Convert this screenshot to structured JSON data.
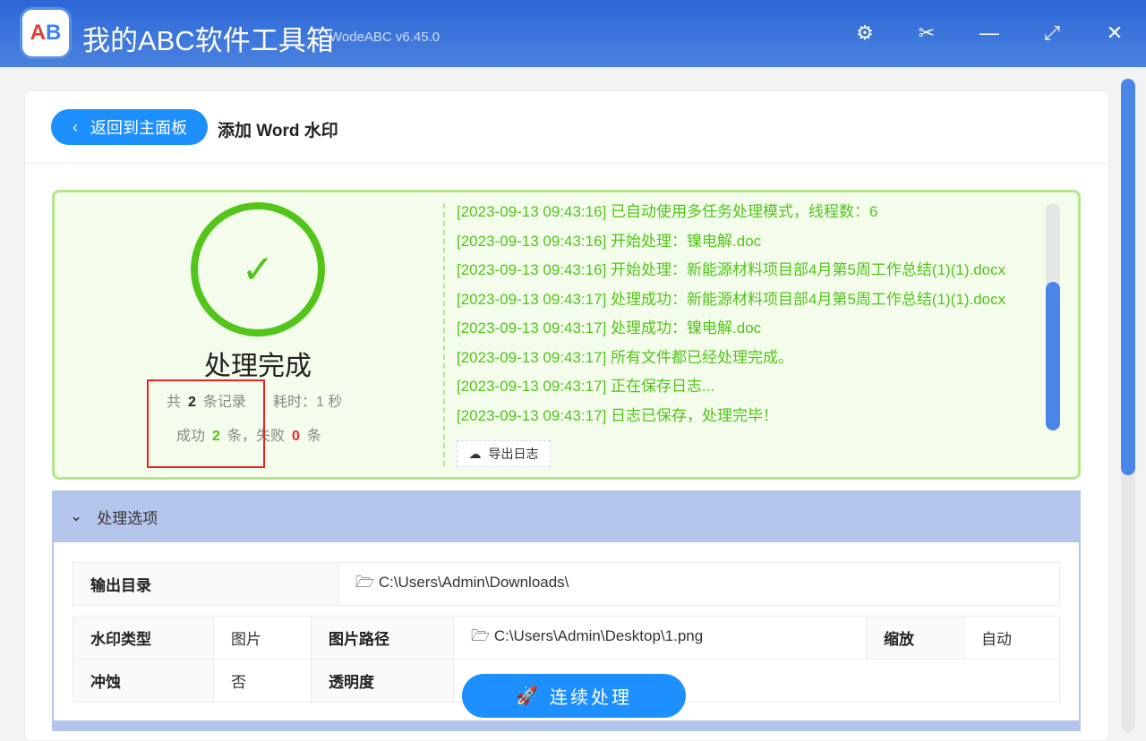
{
  "app": {
    "logo_text": "AB",
    "title": "我的ABC软件工具箱",
    "version": "WodeABC v6.45.0"
  },
  "window_controls": {
    "settings": "⚙",
    "scissors": "✂",
    "minimize": "—",
    "maximize": "⤢",
    "close": "✕"
  },
  "header": {
    "back_label": "返回到主面板",
    "page_title": "添加 Word 水印"
  },
  "result": {
    "status": "处理完成",
    "total_prefix": "共",
    "total": "2",
    "total_suffix": "条记录",
    "time_label": "耗时：1 秒",
    "success_label": "成功",
    "success": "2",
    "success_unit": "条，",
    "fail_label": "失败",
    "fail": "0",
    "fail_unit": "条",
    "log_lines": [
      "[2023-09-13 09:43:16] 已自动使用多任务处理模式，线程数：6",
      "[2023-09-13 09:43:16] 开始处理：镍电解.doc",
      "[2023-09-13 09:43:16] 开始处理：新能源材料项目部4月第5周工作总结(1)(1).docx",
      "[2023-09-13 09:43:17] 处理成功：新能源材料项目部4月第5周工作总结(1)(1).docx",
      "[2023-09-13 09:43:17] 处理成功：镍电解.doc",
      "[2023-09-13 09:43:17] 所有文件都已经处理完成。",
      "[2023-09-13 09:43:17] 正在保存日志...",
      "[2023-09-13 09:43:17] 日志已保存，处理完毕！"
    ],
    "export_label": "导出日志"
  },
  "options": {
    "title": "处理选项",
    "output_dir_label": "输出目录",
    "output_dir": "C:\\Users\\Admin\\Downloads\\",
    "wm_type_label": "水印类型",
    "wm_type": "图片",
    "img_path_label": "图片路径",
    "img_path": "C:\\Users\\Admin\\Desktop\\1.png",
    "scale_label": "缩放",
    "scale": "自动",
    "erode_label": "冲蚀",
    "erode": "否",
    "opacity_label": "透明度"
  },
  "action": {
    "continue_label": "连续处理"
  },
  "colors": {
    "accent": "#1e8fff",
    "success": "#52c41a",
    "fail": "#f5222d",
    "titlebar": "#2c66d6"
  }
}
